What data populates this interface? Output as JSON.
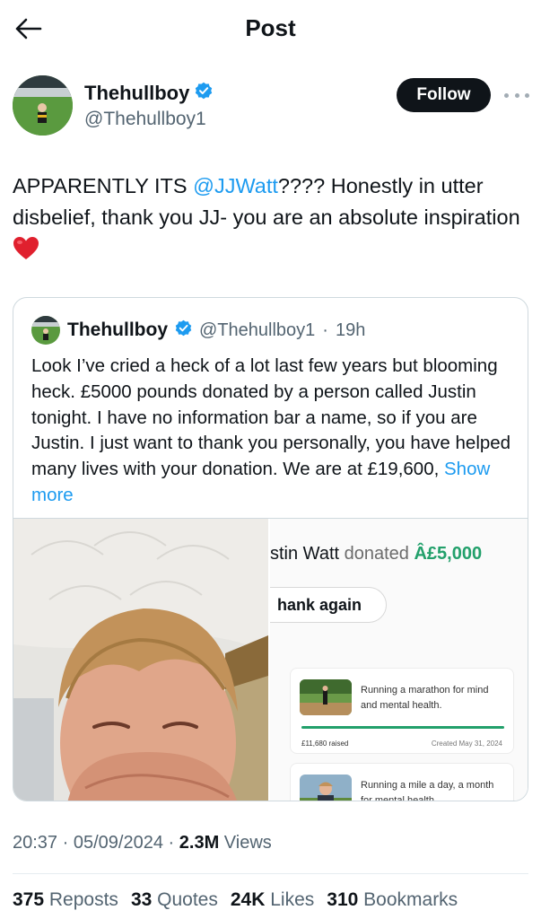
{
  "header": {
    "title": "Post"
  },
  "author": {
    "name": "Thehullboy",
    "handle": "@Thehullboy1",
    "verified": true
  },
  "follow_label": "Follow",
  "tweet": {
    "text_before": "APPARENTLY ITS ",
    "mention": "@JJWatt",
    "text_after": "???? Honestly in utter disbelief, thank you JJ- you are an absolute inspiration ",
    "emoji": "heart"
  },
  "quoted": {
    "name": "Thehullboy",
    "handle": "@Thehullboy1",
    "time": "19h",
    "text": "Look I’ve cried a heck of a lot last few years but blooming heck. £5000 pounds donated by a person called Justin tonight. I have no information bar a name, so if you are Justin. I just want to thank you personally, you have helped many lives with your donation. We are at £19,600, ",
    "show_more": "Show more",
    "screenshot": {
      "donor": "stin Watt",
      "donated_word": "donated",
      "amount": "Â£5,000",
      "thank_button": "hank again",
      "card1": {
        "title": "Running a marathon for mind and mental health.",
        "raised": "£11,680 raised",
        "created": "Created May 31, 2024",
        "progress": 1.0
      },
      "card2": {
        "title": "Running a mile a day, a month for mental health"
      }
    }
  },
  "meta": {
    "time": "20:37",
    "date": "05/09/2024",
    "views_count": "2.3M",
    "views_label": "Views"
  },
  "stats": {
    "reposts_count": "375",
    "reposts_label": "Reposts",
    "quotes_count": "33",
    "quotes_label": "Quotes",
    "likes_count": "24K",
    "likes_label": "Likes",
    "bookmarks_count": "310",
    "bookmarks_label": "Bookmarks"
  },
  "colors": {
    "accent": "#1d9bf0",
    "verified": "#1d9bf0",
    "donation_green": "#22a06b"
  }
}
